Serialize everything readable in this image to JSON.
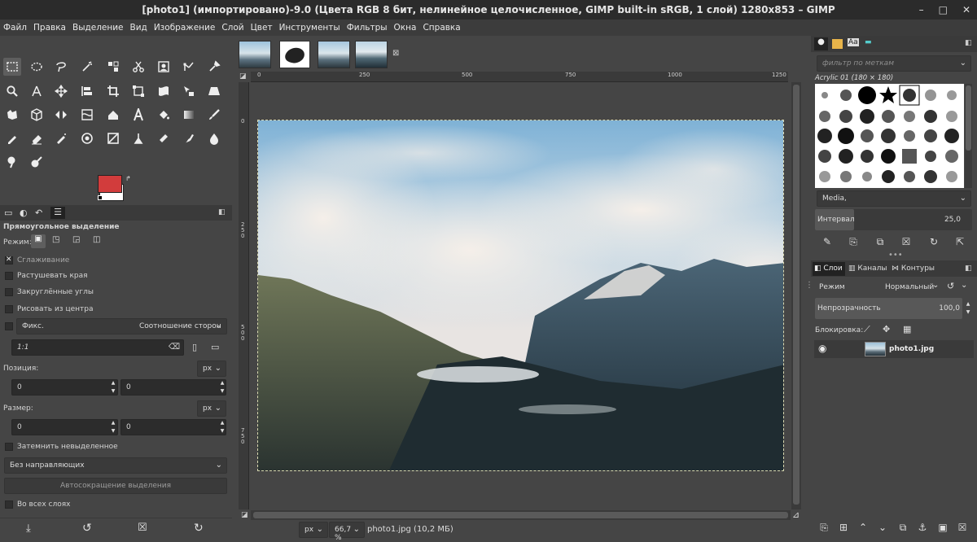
{
  "window": {
    "title": "[photo1] (импортировано)-9.0 (Цвета RGB 8 бит, нелинейное целочисленное, GIMP built-in sRGB, 1 слой) 1280x853 – GIMP",
    "minimize": "–",
    "maximize": "□",
    "close": "✕"
  },
  "menu": [
    "Файл",
    "Правка",
    "Выделение",
    "Вид",
    "Изображение",
    "Слой",
    "Цвет",
    "Инструменты",
    "Фильтры",
    "Окна",
    "Справка"
  ],
  "tool_options": {
    "title": "Прямоугольное выделение",
    "mode_label": "Режим:",
    "antialias": "Сглаживание",
    "feather": "Растушевать края",
    "rounded": "Закруглённые углы",
    "from_center": "Рисовать из центра",
    "fixed_label": "Фикс.",
    "fixed_combo": "Соотношение сторон",
    "ratio_value": "1:1",
    "position_label": "Позиция:",
    "pos_x": "0",
    "pos_y": "0",
    "size_label": "Размер:",
    "size_w": "0",
    "size_h": "0",
    "unit": "px",
    "highlight": "Затемнить невыделенное",
    "guides": "Без направляющих",
    "autoshrink": "Автосокращение выделения",
    "all_layers": "Во всех слоях"
  },
  "ruler": {
    "h": [
      "0",
      "250",
      "500",
      "750",
      "1000",
      "1250"
    ],
    "v": [
      "0",
      "2\n5\n0",
      "5\n0\n0",
      "7\n5\n0"
    ]
  },
  "status": {
    "unit": "px",
    "zoom": "66,7 %",
    "file": "photo1.jpg (10,2 МБ)"
  },
  "brushes": {
    "filter_placeholder": "фильтр по меткам",
    "current": "Acrylic 01 (180 × 180)",
    "tag": "Media,",
    "spacing_label": "Интервал",
    "spacing_value": "25,0"
  },
  "layers": {
    "tabs": [
      "Слои",
      "Каналы",
      "Контуры"
    ],
    "mode_label": "Режим",
    "mode_value": "Нормальный",
    "opacity_label": "Непрозрачность",
    "opacity_value": "100,0",
    "lock_label": "Блокировка:",
    "layer_name": "photo1.jpg"
  },
  "colors": {
    "fg": "#d23c3c",
    "bg": "#ffffff",
    "accent": "#5a5a5a"
  }
}
